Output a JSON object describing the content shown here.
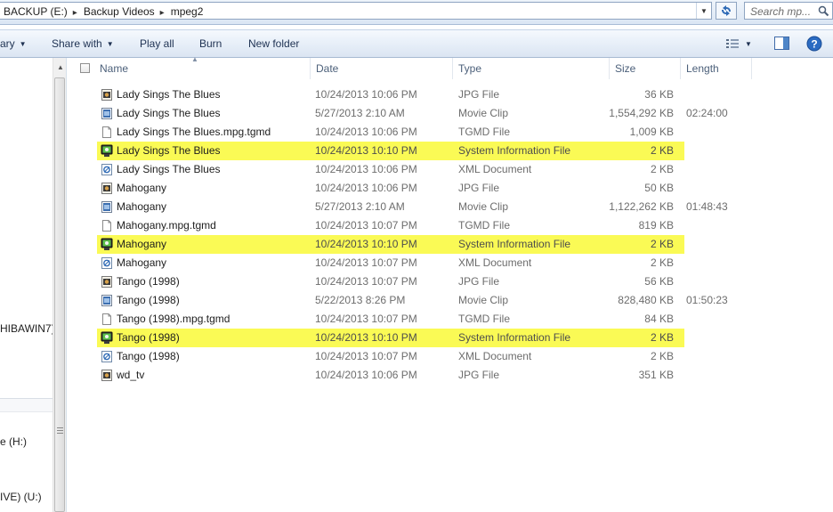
{
  "address_bar": {
    "crumbs": [
      "BACKUP (E:)",
      "Backup Videos",
      "mpeg2"
    ],
    "search_placeholder": "Search mp..."
  },
  "command_bar": {
    "library_label": "ary",
    "share_label": "Share with",
    "play_all_label": "Play all",
    "burn_label": "Burn",
    "new_folder_label": "New folder"
  },
  "nav_pane": {
    "items": [
      "HIBAWIN7)",
      "e (H:)",
      "IVE) (U:)"
    ]
  },
  "columns": {
    "name": "Name",
    "date": "Date",
    "type": "Type",
    "size": "Size",
    "length": "Length"
  },
  "files": [
    {
      "name": "Lady Sings The Blues",
      "date": "10/24/2013 10:06 PM",
      "type": "JPG File",
      "size": "36 KB",
      "length": "",
      "icon": "jpg-icon",
      "highlight": false
    },
    {
      "name": "Lady Sings The Blues",
      "date": "5/27/2013 2:10 AM",
      "type": "Movie Clip",
      "size": "1,554,292 KB",
      "length": "02:24:00",
      "icon": "movie-icon",
      "highlight": false
    },
    {
      "name": "Lady Sings The Blues.mpg.tgmd",
      "date": "10/24/2013 10:06 PM",
      "type": "TGMD File",
      "size": "1,009 KB",
      "length": "",
      "icon": "file-icon",
      "highlight": false
    },
    {
      "name": "Lady Sings The Blues",
      "date": "10/24/2013 10:10 PM",
      "type": "System Information File",
      "size": "2 KB",
      "length": "",
      "icon": "sysinfo-icon",
      "highlight": true
    },
    {
      "name": "Lady Sings The Blues",
      "date": "10/24/2013 10:06 PM",
      "type": "XML Document",
      "size": "2 KB",
      "length": "",
      "icon": "xml-icon",
      "highlight": false
    },
    {
      "name": "Mahogany",
      "date": "10/24/2013 10:06 PM",
      "type": "JPG File",
      "size": "50 KB",
      "length": "",
      "icon": "jpg-icon",
      "highlight": false
    },
    {
      "name": "Mahogany",
      "date": "5/27/2013 2:10 AM",
      "type": "Movie Clip",
      "size": "1,122,262 KB",
      "length": "01:48:43",
      "icon": "movie-icon",
      "highlight": false
    },
    {
      "name": "Mahogany.mpg.tgmd",
      "date": "10/24/2013 10:07 PM",
      "type": "TGMD File",
      "size": "819 KB",
      "length": "",
      "icon": "file-icon",
      "highlight": false
    },
    {
      "name": "Mahogany",
      "date": "10/24/2013 10:10 PM",
      "type": "System Information File",
      "size": "2 KB",
      "length": "",
      "icon": "sysinfo-icon",
      "highlight": true
    },
    {
      "name": "Mahogany",
      "date": "10/24/2013 10:07 PM",
      "type": "XML Document",
      "size": "2 KB",
      "length": "",
      "icon": "xml-icon",
      "highlight": false
    },
    {
      "name": "Tango (1998)",
      "date": "10/24/2013 10:07 PM",
      "type": "JPG File",
      "size": "56 KB",
      "length": "",
      "icon": "jpg-icon",
      "highlight": false
    },
    {
      "name": "Tango (1998)",
      "date": "5/22/2013 8:26 PM",
      "type": "Movie Clip",
      "size": "828,480 KB",
      "length": "01:50:23",
      "icon": "movie-icon",
      "highlight": false
    },
    {
      "name": "Tango (1998).mpg.tgmd",
      "date": "10/24/2013 10:07 PM",
      "type": "TGMD File",
      "size": "84 KB",
      "length": "",
      "icon": "file-icon",
      "highlight": false
    },
    {
      "name": "Tango (1998)",
      "date": "10/24/2013 10:10 PM",
      "type": "System Information File",
      "size": "2 KB",
      "length": "",
      "icon": "sysinfo-icon",
      "highlight": true
    },
    {
      "name": "Tango (1998)",
      "date": "10/24/2013 10:07 PM",
      "type": "XML Document",
      "size": "2 KB",
      "length": "",
      "icon": "xml-icon",
      "highlight": false
    },
    {
      "name": "wd_tv",
      "date": "10/24/2013 10:06 PM",
      "type": "JPG File",
      "size": "351 KB",
      "length": "",
      "icon": "jpg-icon",
      "highlight": false
    }
  ],
  "colors": {
    "highlight": "#fafa55",
    "header_text": "#4c607a",
    "secondary_text": "#6d6d6d"
  }
}
